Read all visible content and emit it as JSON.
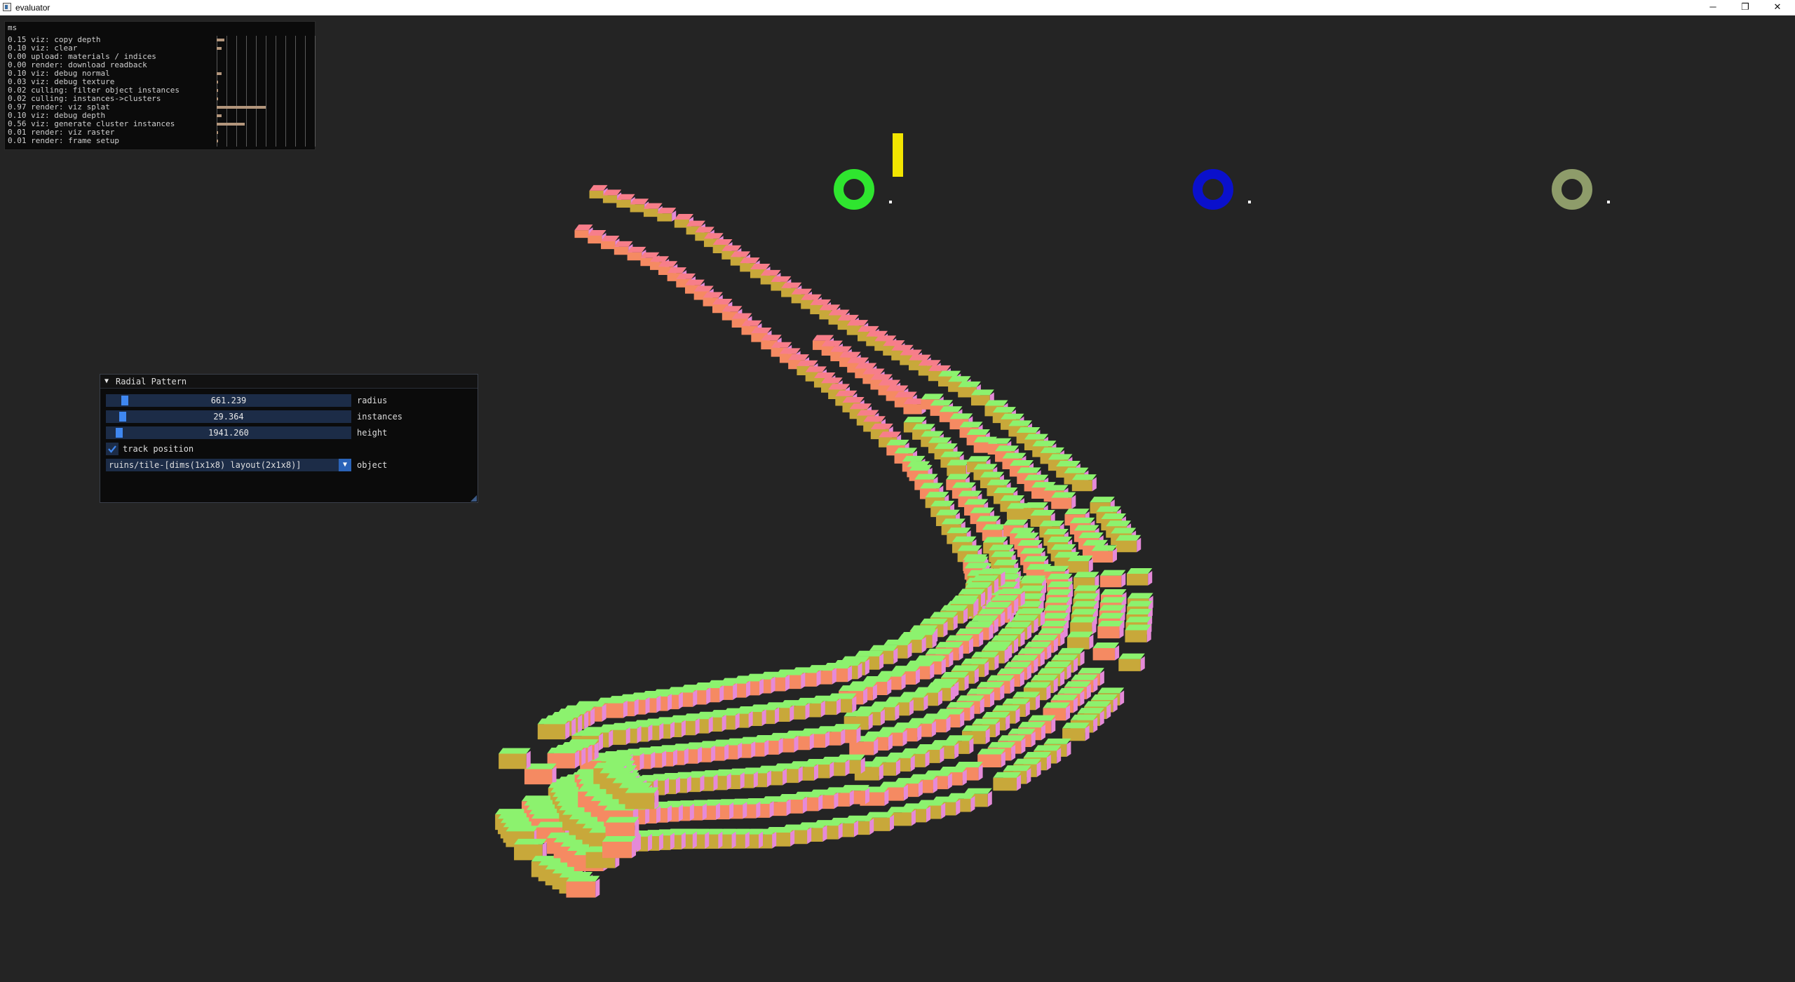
{
  "window": {
    "title": "evaluator",
    "minimize_glyph": "─",
    "maximize_glyph": "❐",
    "close_glyph": "✕"
  },
  "profiler": {
    "unit": "ms",
    "rows": [
      {
        "time": "0.15",
        "label": "viz: copy depth",
        "bar": 0.15
      },
      {
        "time": "0.10",
        "label": "viz: clear",
        "bar": 0.1
      },
      {
        "time": "0.00",
        "label": "upload: materials / indices",
        "bar": 0.0
      },
      {
        "time": "0.00",
        "label": "render: download readback",
        "bar": 0.0
      },
      {
        "time": "0.10",
        "label": "viz: debug normal",
        "bar": 0.1
      },
      {
        "time": "0.03",
        "label": "viz: debug texture",
        "bar": 0.03
      },
      {
        "time": "0.02",
        "label": "culling: filter object instances",
        "bar": 0.02
      },
      {
        "time": "0.02",
        "label": "culling: instances->clusters",
        "bar": 0.02
      },
      {
        "time": "0.97",
        "label": "render: viz splat",
        "bar": 0.97
      },
      {
        "time": "0.10",
        "label": "viz: debug depth",
        "bar": 0.1
      },
      {
        "time": "0.56",
        "label": "viz: generate cluster instances",
        "bar": 0.56
      },
      {
        "time": "0.01",
        "label": "render: viz raster",
        "bar": 0.01
      },
      {
        "time": "0.01",
        "label": "render: frame setup",
        "bar": 0.01
      }
    ],
    "bar_color": "#b3967c"
  },
  "panel": {
    "title": "Radial Pattern",
    "sliders": [
      {
        "value": "661.239",
        "label": "radius",
        "fraction": 0.06
      },
      {
        "value": "29.364",
        "label": "instances",
        "fraction": 0.05
      },
      {
        "value": "1941.260",
        "label": "height",
        "fraction": 0.035
      }
    ],
    "checkbox": {
      "label": "track position",
      "checked": true
    },
    "combo": {
      "value": "ruins/tile-[dims(1x1x8) layout(2x1x8)]",
      "label": "object"
    }
  },
  "scene": {
    "markers": [
      {
        "name": "green-ring",
        "color": "#2fe52f"
      },
      {
        "name": "blue-ring",
        "color": "#0a10cc"
      },
      {
        "name": "olive-ring",
        "color": "#8e9c6a"
      }
    ],
    "marker_bar_color": "#f2e500",
    "tile_colors": {
      "top": "#8cf26e",
      "front": "#f58a62",
      "side": "#e58ad8",
      "back": "#c8a83a",
      "pink": "#f77e8a"
    }
  },
  "colors": {
    "background": "#242424",
    "accent": "#3f87f0",
    "frame_bg": "#1c2c47"
  }
}
